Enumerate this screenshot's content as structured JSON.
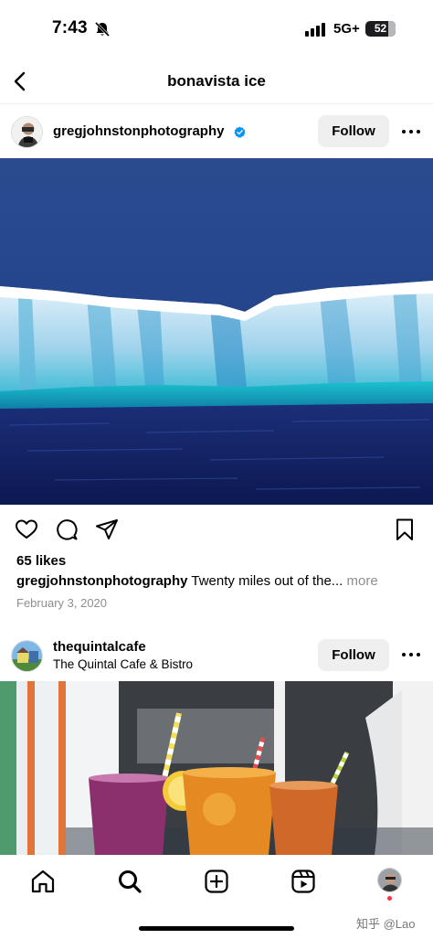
{
  "status_bar": {
    "time": "7:43",
    "network": "5G+",
    "battery": "52",
    "icons": [
      "bell-slash-icon",
      "signal-icon",
      "battery-icon"
    ]
  },
  "header": {
    "title": "bonavista ice",
    "back_icon": "chevron-left-icon"
  },
  "posts": [
    {
      "username": "gregjohnstonphotography",
      "verified": true,
      "follow_label": "Follow",
      "more_icon": "ellipsis-icon",
      "image_subject": "iceberg",
      "likes": "65 likes",
      "caption_user": "gregjohnstonphotography",
      "caption_text": "Twenty miles out of the...",
      "caption_more": "more",
      "date": "February 3, 2020"
    },
    {
      "username": "thequintalcafe",
      "subtitle": "The Quintal Cafe & Bistro",
      "follow_label": "Follow",
      "more_icon": "ellipsis-icon",
      "image_subject": "iced-drinks"
    }
  ],
  "actions": [
    "heart-icon",
    "comment-icon",
    "share-icon",
    "bookmark-icon"
  ],
  "tab_bar": {
    "tabs": [
      "home-icon",
      "search-icon",
      "create-icon",
      "reels-icon",
      "profile-avatar"
    ],
    "active": "search-icon"
  },
  "watermark": "知乎 @Lao",
  "colors": {
    "verified": "#0095f6",
    "follow_bg": "#efefef",
    "notification_dot": "#ff3040",
    "secondary_text": "#8e8e8e"
  }
}
